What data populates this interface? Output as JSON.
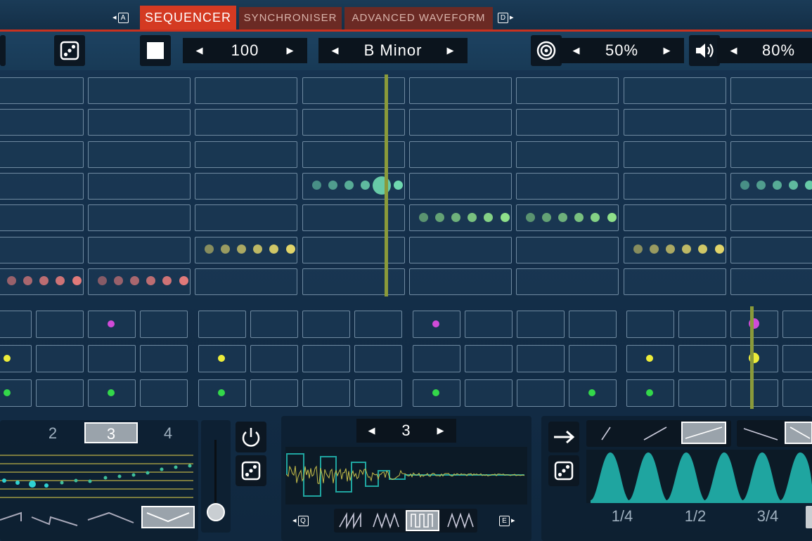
{
  "tabs": {
    "prev_key": "A",
    "next_key": "D",
    "items": [
      {
        "label": "SEQUENCER",
        "active": true
      },
      {
        "label": "SYNCHRONISER",
        "active": false
      },
      {
        "label": "ADVANCED WAVEFORM",
        "active": false
      }
    ]
  },
  "toolbar": {
    "tempo": "100",
    "scale": "B Minor",
    "target_percent": "50%",
    "volume_percent": "80%"
  },
  "melody_grid": {
    "rows": 7,
    "notes": [
      {
        "row": 6,
        "bar": 0,
        "color": "#e07a7a",
        "count": 6
      },
      {
        "row": 6,
        "bar": 1,
        "color": "#e07a7a",
        "count": 6
      },
      {
        "row": 5,
        "bar": 2,
        "color": "#e2d56a",
        "count": 6
      },
      {
        "row": 3,
        "bar": 3,
        "color": "#6fd8b0",
        "count": 6
      },
      {
        "row": 4,
        "bar": 4,
        "color": "#8fe08a",
        "count": 6
      },
      {
        "row": 4,
        "bar": 5,
        "color": "#8fe08a",
        "count": 6
      },
      {
        "row": 5,
        "bar": 6,
        "color": "#e2d56a",
        "count": 6
      },
      {
        "row": 3,
        "bar": 7,
        "color": "#6fd8b0",
        "count": 6
      }
    ]
  },
  "drum_grid": {
    "rows": 3,
    "hits": [
      {
        "row": 0,
        "step": 2,
        "color": "#d04bd8"
      },
      {
        "row": 0,
        "step": 8,
        "color": "#d04bd8"
      },
      {
        "row": 0,
        "step": 14,
        "color": "#d04bd8"
      },
      {
        "row": 1,
        "step": 0,
        "color": "#ecec3a"
      },
      {
        "row": 1,
        "step": 4,
        "color": "#ecec3a"
      },
      {
        "row": 1,
        "step": 12,
        "color": "#ecec3a"
      },
      {
        "row": 1,
        "step": 14,
        "color": "#ecec3a"
      },
      {
        "row": 2,
        "step": 0,
        "color": "#33d84a"
      },
      {
        "row": 2,
        "step": 2,
        "color": "#33d84a"
      },
      {
        "row": 2,
        "step": 4,
        "color": "#33d84a"
      },
      {
        "row": 2,
        "step": 8,
        "color": "#33d84a"
      },
      {
        "row": 2,
        "step": 11,
        "color": "#33d84a"
      },
      {
        "row": 2,
        "step": 12,
        "color": "#33d84a"
      }
    ]
  },
  "arp_panel": {
    "options": [
      "2",
      "3",
      "4"
    ],
    "selected": "3"
  },
  "wave_panel": {
    "value": "3",
    "prev_key": "Q",
    "next_key": "E"
  },
  "envelope_panel": {
    "divisions": [
      "1/4",
      "1/2",
      "3/4"
    ]
  },
  "colors": {
    "accent": "#d43a22",
    "grid_line": "#6f8aa1",
    "teal": "#1fa5a0"
  }
}
